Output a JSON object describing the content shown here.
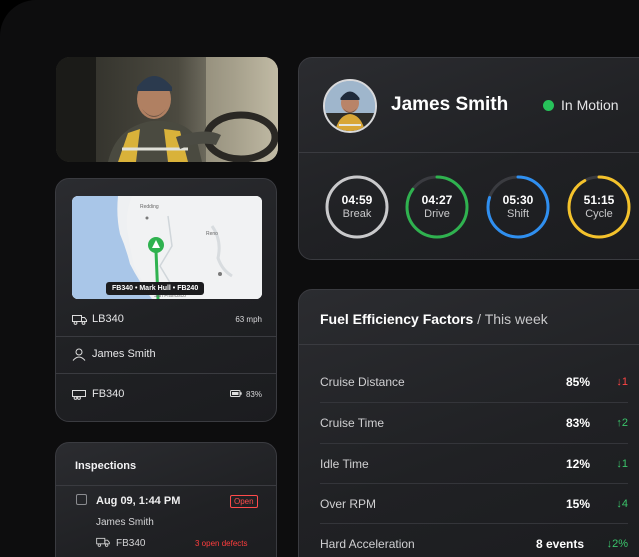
{
  "map": {
    "route_label": "FB340  •  Mark Hull  •  FB240",
    "cities": [
      "Redding",
      "Reno",
      "San Francisco"
    ]
  },
  "vehicle_rows": [
    {
      "icon": "truck-icon",
      "label": "LB340",
      "right": "63 mph"
    },
    {
      "icon": "user-icon",
      "label": "James Smith",
      "right": ""
    },
    {
      "icon": "trailer-icon",
      "label": "FB340",
      "right": "83%"
    }
  ],
  "inspections": {
    "title": "Inspections",
    "items": [
      {
        "date": "Aug 09, 1:44 PM",
        "status": "Open",
        "driver": "James Smith",
        "vehicle": "FB340",
        "defects": "3 open defects"
      }
    ]
  },
  "driver": {
    "name": "James Smith",
    "status": "In Motion",
    "status_color": "#27c25a",
    "clocks": [
      {
        "time": "04:59",
        "label": "Break",
        "color": "#c9c9cb",
        "progress": 1.0
      },
      {
        "time": "04:27",
        "label": "Drive",
        "color": "#2fb24f",
        "progress": 0.85
      },
      {
        "time": "05:30",
        "label": "Shift",
        "color": "#2f8ff0",
        "progress": 0.8
      },
      {
        "time": "51:15",
        "label": "Cycle",
        "color": "#f4c22b",
        "progress": 0.92
      }
    ]
  },
  "fuel": {
    "title": "Fuel Efficiency Factors",
    "period": "This week",
    "rows": [
      {
        "label": "Cruise Distance",
        "value": "85%",
        "arrow": "↓",
        "change": "1",
        "trend": "down-red"
      },
      {
        "label": "Cruise Time",
        "value": "83%",
        "arrow": "↑",
        "change": "2",
        "trend": "up-green"
      },
      {
        "label": "Idle Time",
        "value": "12%",
        "arrow": "↓",
        "change": "1",
        "trend": "down-green"
      },
      {
        "label": "Over RPM",
        "value": "15%",
        "arrow": "↓",
        "change": "4",
        "trend": "down-green"
      },
      {
        "label": "Hard Acceleration",
        "value": "8 events",
        "arrow": "↓",
        "change": "2%",
        "trend": "down-green"
      }
    ]
  }
}
